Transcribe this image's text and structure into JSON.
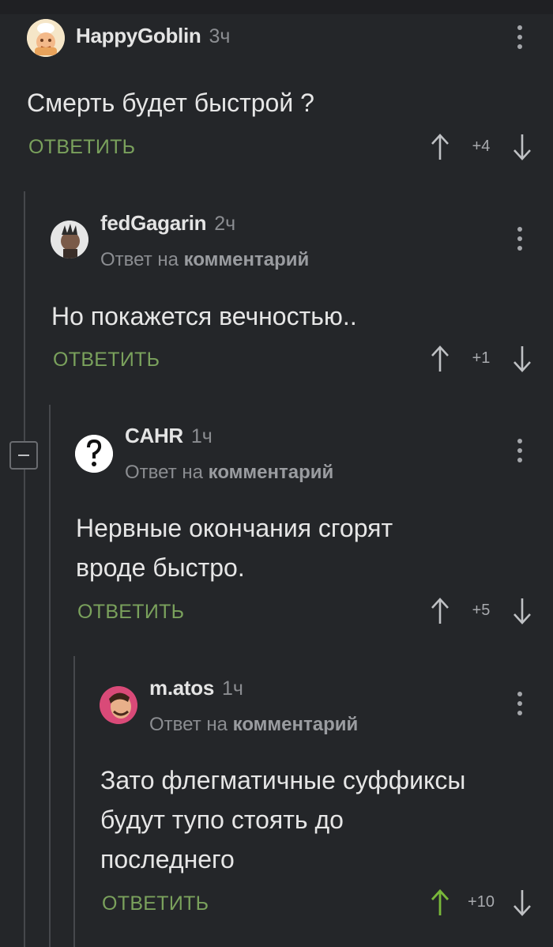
{
  "comments": [
    {
      "username": "HappyGoblin",
      "time": "3ч",
      "reply_prefix": "",
      "reply_bold": "",
      "text": "Смерть будет быстрой ?",
      "reply_label": "ОТВЕТИТЬ",
      "score": "+4"
    },
    {
      "username": "fedGagarin",
      "time": "2ч",
      "reply_prefix": "Ответ на",
      "reply_bold": "комментарий",
      "text": "Но покажется вечностью..",
      "reply_label": "ОТВЕТИТЬ",
      "score": "+1"
    },
    {
      "username": "CAHR",
      "time": "1ч",
      "reply_prefix": "Ответ на",
      "reply_bold": "комментарий",
      "text_lines": [
        "Нервные окончания сгорят",
        "вроде быстро."
      ],
      "reply_label": "ОТВЕТИТЬ",
      "score": "+5"
    },
    {
      "username": "m.atos",
      "time": "1ч",
      "reply_prefix": "Ответ на",
      "reply_bold": "комментарий",
      "text_lines": [
        "Зато флегматичные суффиксы",
        "будут тупо стоять до",
        "последнего"
      ],
      "reply_label": "ОТВЕТИТЬ",
      "score": "+10",
      "upvoted": true
    }
  ],
  "colors": {
    "background": "#242629",
    "reply_link": "#7aa15c",
    "upvote_active": "#79b83a",
    "muted": "#8b8d91"
  },
  "icons": [
    "avatar",
    "more-vertical-icon",
    "arrow-up-icon",
    "arrow-down-icon",
    "collapse-minus-icon"
  ]
}
